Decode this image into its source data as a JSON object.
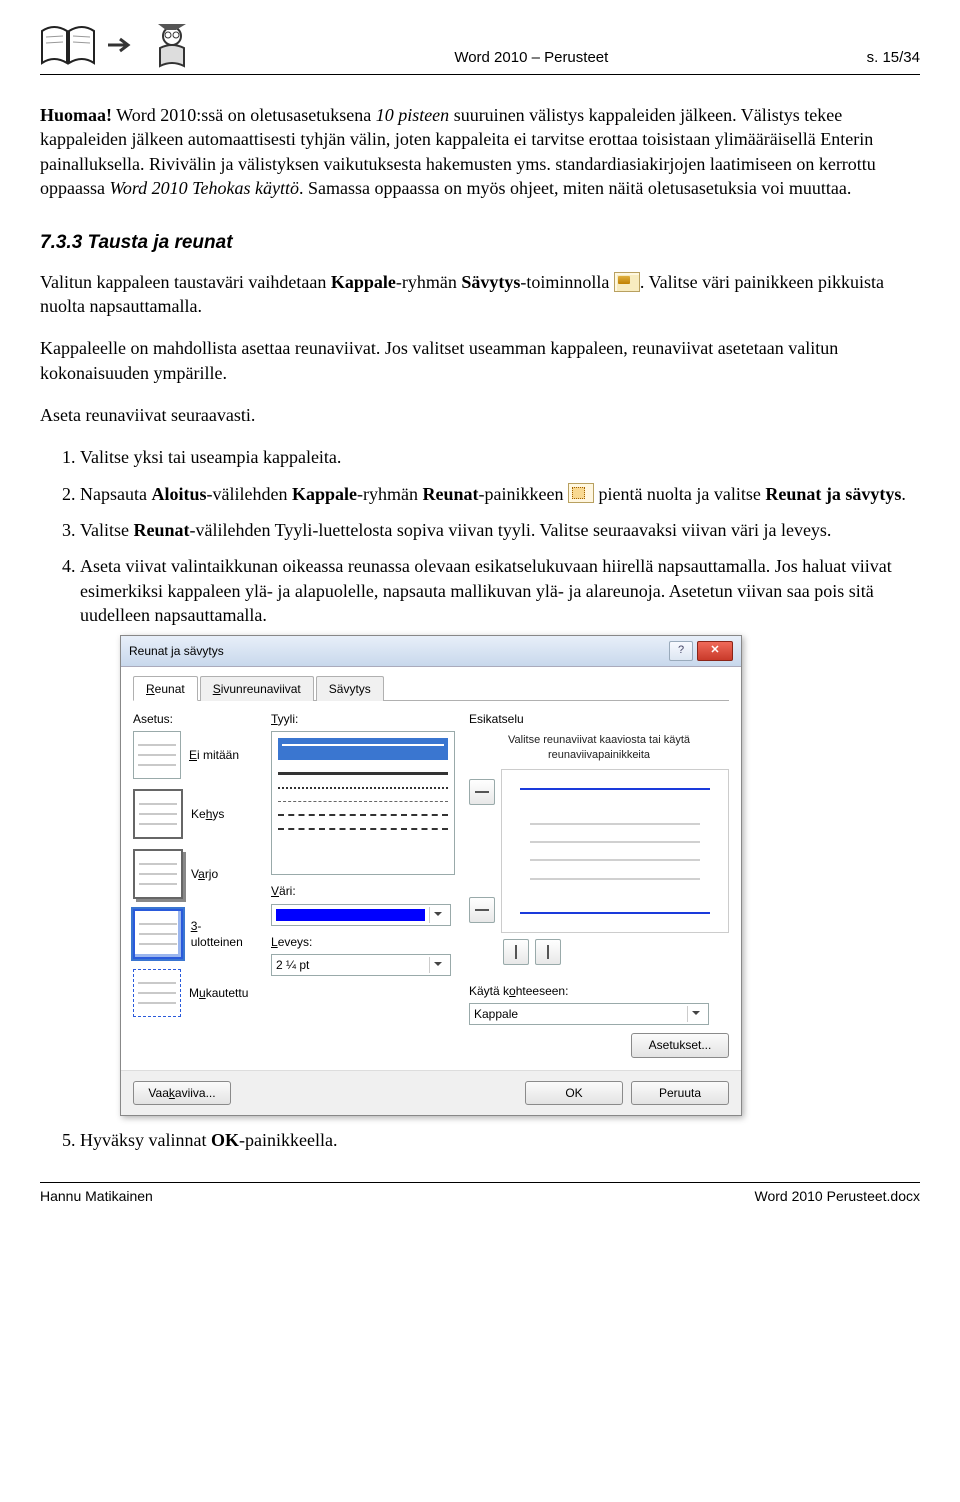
{
  "header": {
    "center": "Word 2010 – Perusteet",
    "right": "s. 15/34"
  },
  "footer": {
    "left": "Hannu Matikainen",
    "right": "Word 2010 Perusteet.docx"
  },
  "p1": {
    "lead": "Huomaa!",
    "t1": " Word 2010:ssä on oletusasetuksena ",
    "i1": "10 pisteen",
    "t2": " suuruinen välistys kappaleiden jälkeen. Välistys tekee kappaleiden jälkeen automaattisesti tyhjän välin, joten kappaleita ei tarvitse erottaa toisistaan ylimääräisellä Enterin painalluksella. Rivivälin ja välistyksen vaikutuksesta hakemusten yms. standardiasiakirjojen laatimiseen on kerrottu oppaassa ",
    "i2": "Word 2010 Tehokas käyttö",
    "t3": ". Samassa oppaassa on myös ohjeet, miten näitä oletusasetuksia voi muuttaa."
  },
  "section": "7.3.3 Tausta ja reunat",
  "p2": {
    "t1": "Valitun kappaleen taustaväri vaihdetaan ",
    "b1": "Kappale",
    "t2": "-ryhmän ",
    "b2": "Sävytys",
    "t3": "-toiminnolla ",
    "t4": ". Valitse väri painikkeen pikkuista nuolta napsauttamalla."
  },
  "p3": "Kappaleelle on mahdollista asettaa reunaviivat. Jos valitset useamman kappaleen, reunaviivat asetetaan valitun kokonaisuuden ympärille.",
  "p4": "Aseta reunaviivat seuraavasti.",
  "steps": {
    "s1": "Valitse yksi tai useampia kappaleita.",
    "s2": {
      "t1": "Napsauta ",
      "b1": "Aloitus",
      "t2": "-välilehden ",
      "b2": "Kappale",
      "t3": "-ryhmän ",
      "b3": "Reunat",
      "t4": "-painikkeen ",
      "t5": " pientä nuolta ja valitse ",
      "b4": "Reunat ja sävytys",
      "t6": "."
    },
    "s3": {
      "t1": "Valitse ",
      "b1": "Reunat",
      "t2": "-välilehden Tyyli-luettelosta sopiva viivan tyyli. Valitse seuraavaksi viivan väri ja leveys."
    },
    "s4": "Aseta viivat valintaikkunan oikeassa reunassa olevaan esikatselukuvaan hiirellä napsauttamalla. Jos haluat viivat esimerkiksi kappaleen ylä- ja alapuolelle, napsauta mallikuvan ylä- ja alareunoja. Asetetun viivan saa pois sitä uudelleen napsauttamalla.",
    "s5": {
      "t1": "Hyväksy valinnat ",
      "b1": "OK",
      "t2": "-painikkeella."
    }
  },
  "dialog": {
    "title": "Reunat ja sävytys",
    "tabs": [
      "Reunat",
      "Sivunreunaviivat",
      "Sävytys"
    ],
    "labels": {
      "asetus": "Asetus:",
      "tyyli": "Tyyli:",
      "vari": "Väri:",
      "leveys": "Leveys:",
      "esikatselu": "Esikatselu",
      "kohde": "Käytä kohteeseen:"
    },
    "asetus_items": {
      "ei": "Ei mitään",
      "kehys": "Kehys",
      "varjo": "Varjo",
      "kolmed": "3-ulotteinen",
      "muka": "Mukautettu"
    },
    "leveys_value": "2 ¼ pt",
    "kohde_value": "Kappale",
    "preview_msg": "Valitse reunaviivat kaaviosta tai käytä reunaviivapainikkeita",
    "buttons": {
      "asetukset": "Asetukset...",
      "vaaka": "Vaakaviiva...",
      "ok": "OK",
      "peruuta": "Peruuta"
    }
  }
}
